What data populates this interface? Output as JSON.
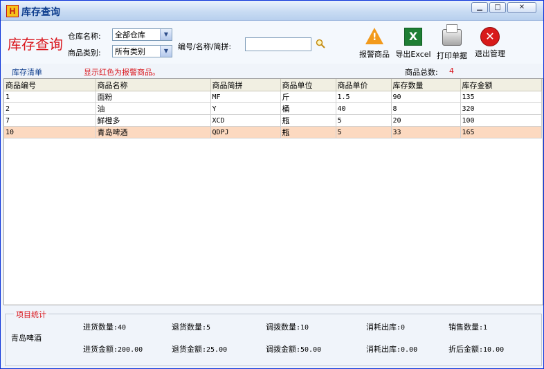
{
  "window": {
    "title": "库存查询",
    "logo_letter": "H"
  },
  "toolbar": {
    "big_title": "库存查询",
    "warehouse_label": "仓库名称:",
    "warehouse_value": "全部仓库",
    "category_label": "商品类别:",
    "category_value": "所有类别",
    "search_label": "编号/名称/简拼:",
    "search_value": "",
    "buttons": [
      {
        "label": "报警商品",
        "icon": "warning-icon"
      },
      {
        "label": "导出Excel",
        "icon": "excel-icon"
      },
      {
        "label": "打印单据",
        "icon": "printer-icon"
      },
      {
        "label": "退出管理",
        "icon": "exit-icon"
      }
    ]
  },
  "list": {
    "title": "库存清单",
    "note": "显示红色为报警商品。",
    "count_label": "商品总数:",
    "count_value": "4"
  },
  "table": {
    "columns": [
      "商品编号",
      "商品名称",
      "商品简拼",
      "商品单位",
      "商品单价",
      "库存数量",
      "库存金额"
    ],
    "rows": [
      [
        "1",
        "面粉",
        "MF",
        "斤",
        "1.5",
        "90",
        "135"
      ],
      [
        "2",
        "油",
        "Y",
        "桶",
        "40",
        "8",
        "320"
      ],
      [
        "7",
        "鲜橙多",
        "XCD",
        "瓶",
        "5",
        "20",
        "100"
      ],
      [
        "10",
        "青岛啤酒",
        "QDPJ",
        "瓶",
        "5",
        "33",
        "165"
      ]
    ],
    "selected_row": 3
  },
  "stats": {
    "legend": "项目统计",
    "item_name": "青岛啤酒",
    "row1": [
      {
        "label": "进货数量",
        "value": ":40"
      },
      {
        "label": "退货数量",
        "value": ":5"
      },
      {
        "label": "调拨数量",
        "value": ":10"
      },
      {
        "label": "消耗出库",
        "value": ":0"
      },
      {
        "label": "销售数量",
        "value": ":1"
      }
    ],
    "row2": [
      {
        "label": "进货金额",
        "value": ":200.00"
      },
      {
        "label": "退货金额",
        "value": ":25.00"
      },
      {
        "label": "调拨金额",
        "value": ":50.00"
      },
      {
        "label": "消耗出库",
        "value": ":0.00"
      },
      {
        "label": "折后金额",
        "value": ":10.00"
      }
    ]
  },
  "colors": {
    "accent_red": "#d9141b",
    "selected_row": "#fcd9c0",
    "title_blue": "#0b3b8c"
  }
}
